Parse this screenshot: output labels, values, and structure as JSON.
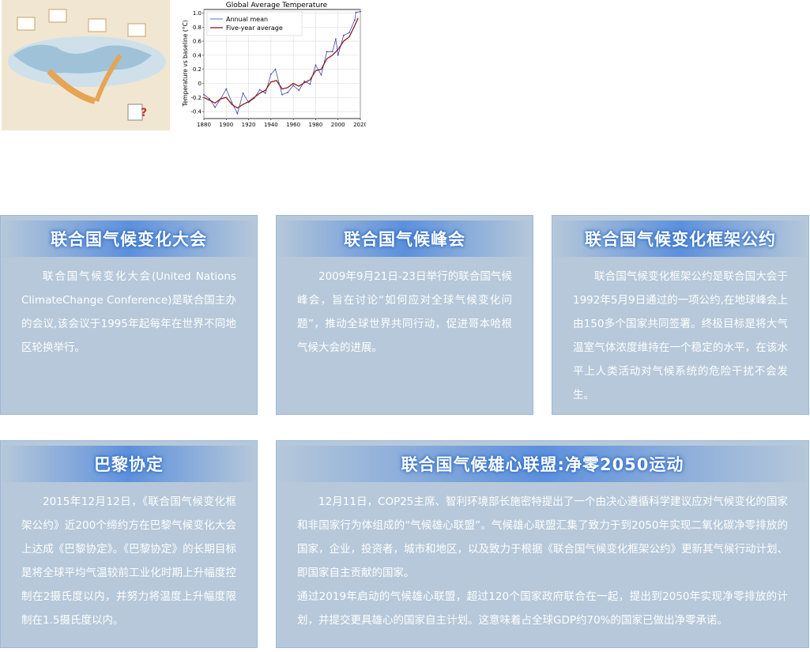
{
  "chart_data": {
    "type": "line",
    "title": "Global Average Temperature",
    "ylabel": "Temperature vs baseline (°C)",
    "xlabel": "",
    "xlim": [
      1880,
      2020
    ],
    "ylim": [
      -0.5,
      1.05
    ],
    "xticks": [
      "1880",
      "1900",
      "1920",
      "1940",
      "1960",
      "1980",
      "2000",
      "2020"
    ],
    "yticks": [
      "-0.4",
      "-0.2",
      "0",
      "0.2",
      "0.4",
      "0.6",
      "0.8",
      "1.0"
    ],
    "legend": "top-left",
    "grid": true,
    "series": [
      {
        "name": "Annual mean",
        "color": "#3a49a8",
        "x": [
          1880,
          1885,
          1890,
          1895,
          1900,
          1905,
          1910,
          1915,
          1920,
          1925,
          1930,
          1935,
          1940,
          1944,
          1950,
          1955,
          1960,
          1965,
          1970,
          1975,
          1980,
          1985,
          1990,
          1995,
          1998,
          2000,
          2005,
          2010,
          2015,
          2016,
          2020
        ],
        "values": [
          -0.16,
          -0.22,
          -0.34,
          -0.22,
          -0.08,
          -0.27,
          -0.43,
          -0.14,
          -0.27,
          -0.21,
          -0.09,
          -0.14,
          0.13,
          0.2,
          -0.16,
          -0.13,
          -0.03,
          -0.1,
          0.03,
          -0.01,
          0.26,
          0.12,
          0.45,
          0.45,
          0.63,
          0.4,
          0.68,
          0.72,
          0.9,
          1.01,
          1.02
        ]
      },
      {
        "name": "Five-year average",
        "color": "#8b1a1a",
        "x": [
          1880,
          1885,
          1890,
          1895,
          1900,
          1905,
          1910,
          1915,
          1920,
          1925,
          1930,
          1935,
          1940,
          1945,
          1950,
          1955,
          1960,
          1965,
          1970,
          1975,
          1980,
          1985,
          1990,
          1995,
          2000,
          2005,
          2010,
          2015,
          2018
        ],
        "values": [
          -0.2,
          -0.24,
          -0.28,
          -0.22,
          -0.2,
          -0.3,
          -0.35,
          -0.3,
          -0.26,
          -0.2,
          -0.14,
          -0.1,
          0.02,
          0.04,
          -0.08,
          -0.06,
          0.0,
          -0.04,
          0.01,
          0.05,
          0.18,
          0.2,
          0.35,
          0.4,
          0.48,
          0.6,
          0.66,
          0.82,
          0.93
        ]
      }
    ]
  },
  "cards": [
    {
      "title": "联合国气候变化大会",
      "paragraphs": [
        "联合国气候变化大会(United Nations ClimateChange Conference)是联合国主办的会议,该会议于1995年起每年在世界不同地区轮换举行。"
      ]
    },
    {
      "title": "联合国气候峰会",
      "paragraphs": [
        "2009年9月21日-23日举行的联合国气候峰会，旨在讨论“如何应对全球气候变化问题”，推动全球世界共同行动，促进哥本哈根气候大会的进展。"
      ]
    },
    {
      "title": "联合国气候变化框架公约",
      "paragraphs": [
        "联合国气候变化框架公约是联合国大会于1992年5月9日通过的一项公约,在地球峰会上由150多个国家共同签署。终极目标是将大气温室气体浓度维持在一个稳定的水平，在该水平上人类活动对气候系统的危险干扰不会发生。"
      ]
    },
    {
      "title": "巴黎协定",
      "paragraphs": [
        "2015年12月12日，《联合国气候变化框架公约》近200个缔约方在巴黎气候变化大会上达成《巴黎协定》。《巴黎协定》的长期目标是将全球平均气温较前工业化时期上升幅度控制在2摄氏度以内，并努力将温度上升幅度限制在1.5摄氏度以内。"
      ]
    },
    {
      "title": "联合国气候雄心联盟:净零2050运动",
      "paragraphs": [
        "12月11日，COP25主席、智利环境部长施密特提出了一个由决心遵循科学建议应对气候变化的国家和非国家行为体组成的“气候雄心联盟”。气候雄心联盟汇集了致力于到2050年实现二氧化碳净零排放的国家，企业，投资者，城市和地区，以及致力于根据《联合国气候变化框架公约》更新其气候行动计划、即国家自主贡献的国家。",
        "通过2019年启动的气候雄心联盟，超过120个国家政府联合在一起，提出到2050年实现净零排放的计划，并提交更具雄心的国家自主计划。这意味着占全球GDP约70%的国家已做出净零承诺。"
      ]
    }
  ]
}
